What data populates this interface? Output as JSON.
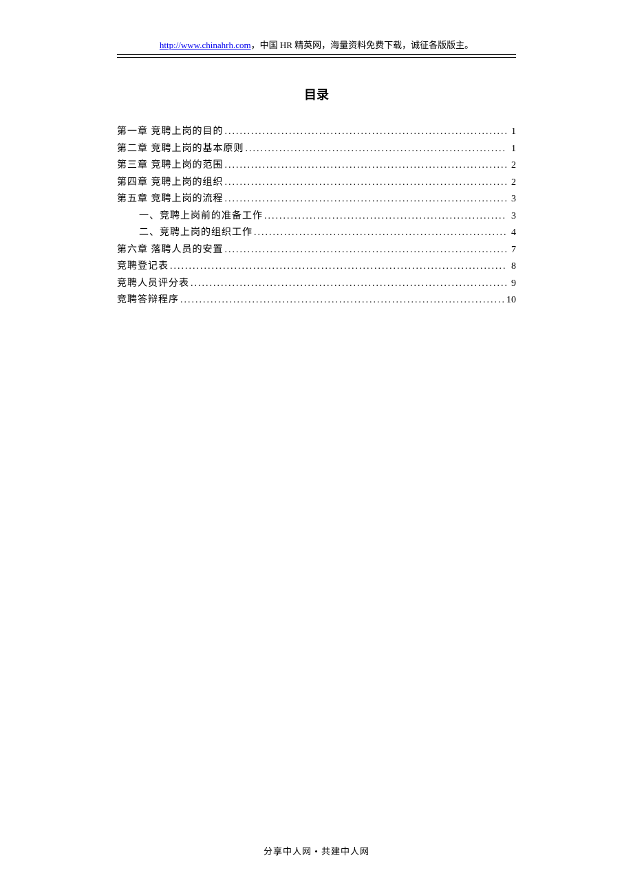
{
  "header": {
    "link_text": "http://www.chinahrh.com",
    "suffix_text": "，中国 HR 精英网，海量资料免费下载，诚征各版版主。"
  },
  "title": "目录",
  "toc": [
    {
      "label": "第一章 竞聘上岗的目的",
      "page": "1",
      "indent": false
    },
    {
      "label": "第二章 竞聘上岗的基本原则",
      "page": "1",
      "indent": false
    },
    {
      "label": "第三章 竞聘上岗的范围",
      "page": "2",
      "indent": false
    },
    {
      "label": "第四章 竞聘上岗的组织",
      "page": "2",
      "indent": false
    },
    {
      "label": "第五章 竞聘上岗的流程",
      "page": "3",
      "indent": false
    },
    {
      "label": "一、竞聘上岗前的准备工作",
      "page": "3",
      "indent": true
    },
    {
      "label": "二、竞聘上岗的组织工作",
      "page": "4",
      "indent": true
    },
    {
      "label": "第六章 落聘人员的安置",
      "page": "7",
      "indent": false
    },
    {
      "label": "竞聘登记表",
      "page": "8",
      "indent": false
    },
    {
      "label": "竞聘人员评分表",
      "page": "9",
      "indent": false
    },
    {
      "label": "竞聘答辩程序",
      "page": "10",
      "indent": false
    }
  ],
  "footer": "分享中人网 • 共建中人网"
}
